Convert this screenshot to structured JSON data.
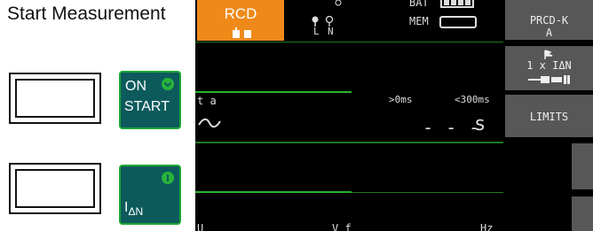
{
  "heading": "Start Measurement",
  "buttons": {
    "on_start": {
      "line1": "ON",
      "line2": "START"
    },
    "idn": {
      "label": "I",
      "sub": "ΔN"
    }
  },
  "screen": {
    "mode_label": "RCD",
    "bat_label": "BAT",
    "mem_label": "MEM",
    "terminal_l": "L",
    "terminal_n": "N",
    "row_label": "t a",
    "range_low": ">0ms",
    "range_high": "<300ms",
    "value": "- - -",
    "unit": "s",
    "bottom_u": "U",
    "bottom_vf": "V f",
    "bottom_hz": "Hz"
  },
  "sidebar": {
    "type_label": "PRCD-K",
    "type_sub": "A",
    "multiplier": "1 x IΔN",
    "limits": "LIMITS"
  },
  "colors": {
    "accent": "#ef8a1a",
    "button_bg": "#0d5a5c",
    "border_green": "#1ea535",
    "softkey": "#575757"
  }
}
